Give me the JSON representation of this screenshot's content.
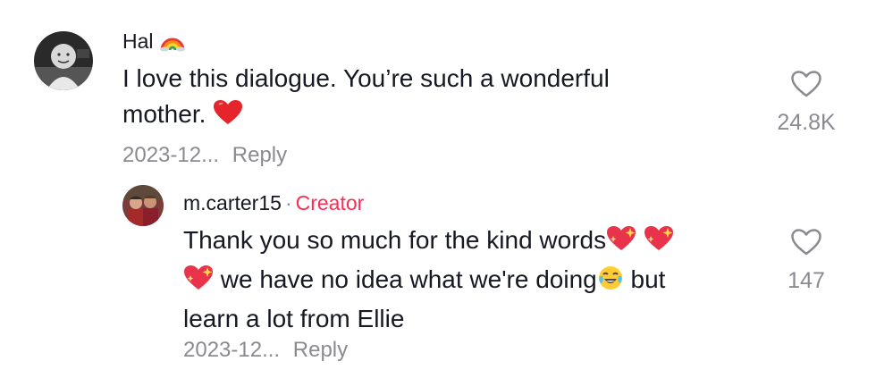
{
  "comments": [
    {
      "username": "Hal",
      "username_badge_icon": "rainbow-icon",
      "text_lines": [
        "I love this dialogue. You’re such a wonderful",
        "mother."
      ],
      "trailing_emoji": "red-heart-icon",
      "date": "2023-12...",
      "reply_label": "Reply",
      "like_count": "24.8K",
      "like_icon": "heart-outline-icon"
    },
    {
      "username": "m.carter15",
      "separator": "·",
      "creator_label": "Creator",
      "text_line1": "Thank you so much for the kind words",
      "text_line2_a": " we have no idea what we're doing",
      "text_line2_b": " but",
      "text_line3": "learn a lot from Ellie",
      "date": "2023-12...",
      "reply_label": "Reply",
      "like_count": "147",
      "like_icon": "heart-outline-icon",
      "emojis": [
        "sparkling-heart-icon",
        "sparkling-heart-icon",
        "sparkling-heart-icon",
        "tears-of-joy-icon"
      ]
    }
  ],
  "colors": {
    "text": "#161823",
    "muted": "#8a8b91",
    "creator": "#fe2c55"
  }
}
